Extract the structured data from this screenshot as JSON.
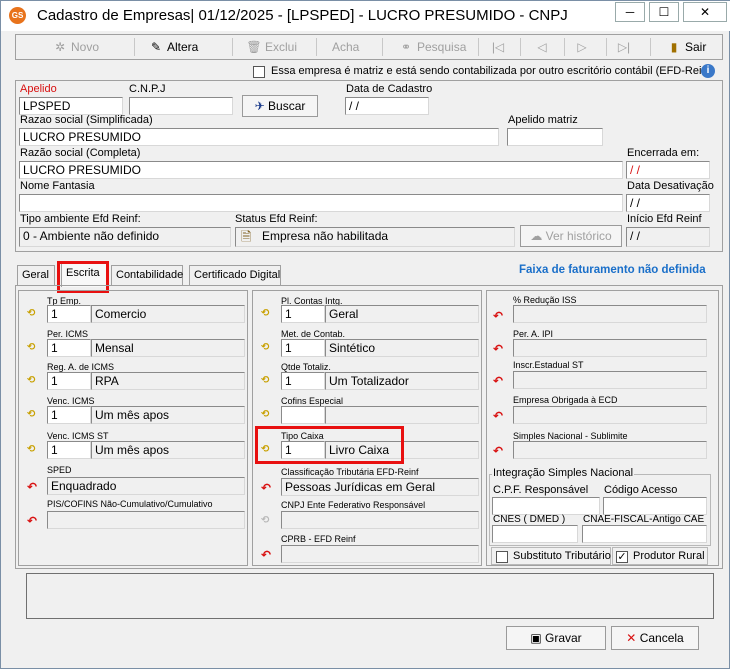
{
  "window": {
    "title": "Cadastro de Empresas|  01/12/2025 - [LPSPED] - LUCRO PRESUMIDO - CNPJ",
    "app_icon_text": "GS",
    "buttons": {
      "minimize": "─",
      "maximize": "☐",
      "close": "✕"
    }
  },
  "toolbar": {
    "novo": "Novo",
    "altera": "Altera",
    "exclui": "Exclui",
    "acha": "Acha",
    "pesquisa": "Pesquisa",
    "sair": "Sair"
  },
  "matriz_checkbox": {
    "label": "Essa empresa é matriz e está sendo contabilizada por outro escritório contábil (EFD-Reinf",
    "checked": false
  },
  "header": {
    "apelido_label": "Apelido",
    "apelido": "LPSPED",
    "cnpj_label": "C.N.P.J",
    "cnpj": "",
    "buscar": "Buscar",
    "data_cadastro_label": "Data de Cadastro",
    "data_cadastro": " / /",
    "razao_simplificada_label": "Razao social (Simplificada)",
    "razao_simplificada": "LUCRO PRESUMIDO",
    "apelido_matriz_label": "Apelido matriz",
    "apelido_matriz": "",
    "razao_completa_label": "Razão social (Completa)",
    "razao_completa": "LUCRO PRESUMIDO",
    "encerrada_label": "Encerrada em:",
    "encerrada": " / /",
    "nome_fantasia_label": "Nome Fantasia",
    "nome_fantasia": "",
    "data_desativacao_label": "Data Desativação",
    "data_desativacao": " / /",
    "tipo_ambiente_label": "Tipo ambiente Efd Reinf:",
    "tipo_ambiente": "0 - Ambiente não definido",
    "status_efd_label": "Status Efd Reinf:",
    "status_efd": "Empresa não habilitada",
    "ver_historico": "Ver histórico",
    "inicio_efd_label": "Início Efd Reinf",
    "inicio_efd": " / /"
  },
  "tabs": [
    "Geral",
    "Escrita",
    "Contabilidade",
    "Certificado Digital"
  ],
  "faixa_warning": "Faixa de faturamento não definida",
  "col1": [
    {
      "label": "Tp Emp.",
      "code": "1",
      "desc": "Comercio"
    },
    {
      "label": "Per. ICMS",
      "code": "1",
      "desc": "Mensal"
    },
    {
      "label": "Reg. A. de ICMS",
      "code": "1",
      "desc": "RPA"
    },
    {
      "label": "Venc. ICMS",
      "code": "1",
      "desc": "Um mês apos"
    },
    {
      "label": "Venc. ICMS ST",
      "code": "1",
      "desc": "Um mês apos"
    },
    {
      "label": "SPED",
      "code": "",
      "desc": "Enquadrado"
    },
    {
      "label": "PIS/COFINS Não-Cumulativo/Cumulativo",
      "code": "",
      "desc": ""
    }
  ],
  "col2": [
    {
      "label": "Pl. Contas Intg.",
      "code": "1",
      "desc": "Geral"
    },
    {
      "label": "Met. de Contab.",
      "code": "1",
      "desc": "Sintético"
    },
    {
      "label": "Qtde Totaliz.",
      "code": "1",
      "desc": "Um Totalizador"
    },
    {
      "label": "Cofins Especial",
      "code": "",
      "desc": ""
    },
    {
      "label": "Tipo Caixa",
      "code": "1",
      "desc": "Livro Caixa"
    },
    {
      "label": "Classificação Tributária EFD-Reinf",
      "code": "",
      "desc": "Pessoas Jurídicas em Geral"
    },
    {
      "label": "CNPJ Ente Federativo Responsável",
      "code": "",
      "desc": ""
    },
    {
      "label": "CPRB - EFD Reinf",
      "code": "",
      "desc": ""
    }
  ],
  "col3": [
    {
      "label": "% Redução ISS"
    },
    {
      "label": "Per. A.  IPI"
    },
    {
      "label": "Inscr.Estadual ST"
    },
    {
      "label": "Empresa Obrigada à ECD"
    },
    {
      "label": "Simples Nacional - Sublimite"
    }
  ],
  "integracao": {
    "title": "Integração Simples Nacional",
    "cpf_label": "C.P.F. Responsável",
    "cpf": "",
    "codigo_label": "Código Acesso",
    "codigo": "",
    "cnes_label": "CNES ( DMED )",
    "cnes": "",
    "cnae_label": "CNAE-FISCAL-Antigo CAE",
    "cnae": ""
  },
  "checks": {
    "substituto_label": "Substituto Tributário",
    "substituto_checked": false,
    "produtor_label": "Produtor Rural",
    "produtor_checked": true
  },
  "footer": {
    "gravar": "Gravar",
    "cancela": "Cancela"
  },
  "colors": {
    "accent_blue": "#1a6fc9",
    "highlight_red": "#e81010",
    "required_red": "#d81010"
  }
}
